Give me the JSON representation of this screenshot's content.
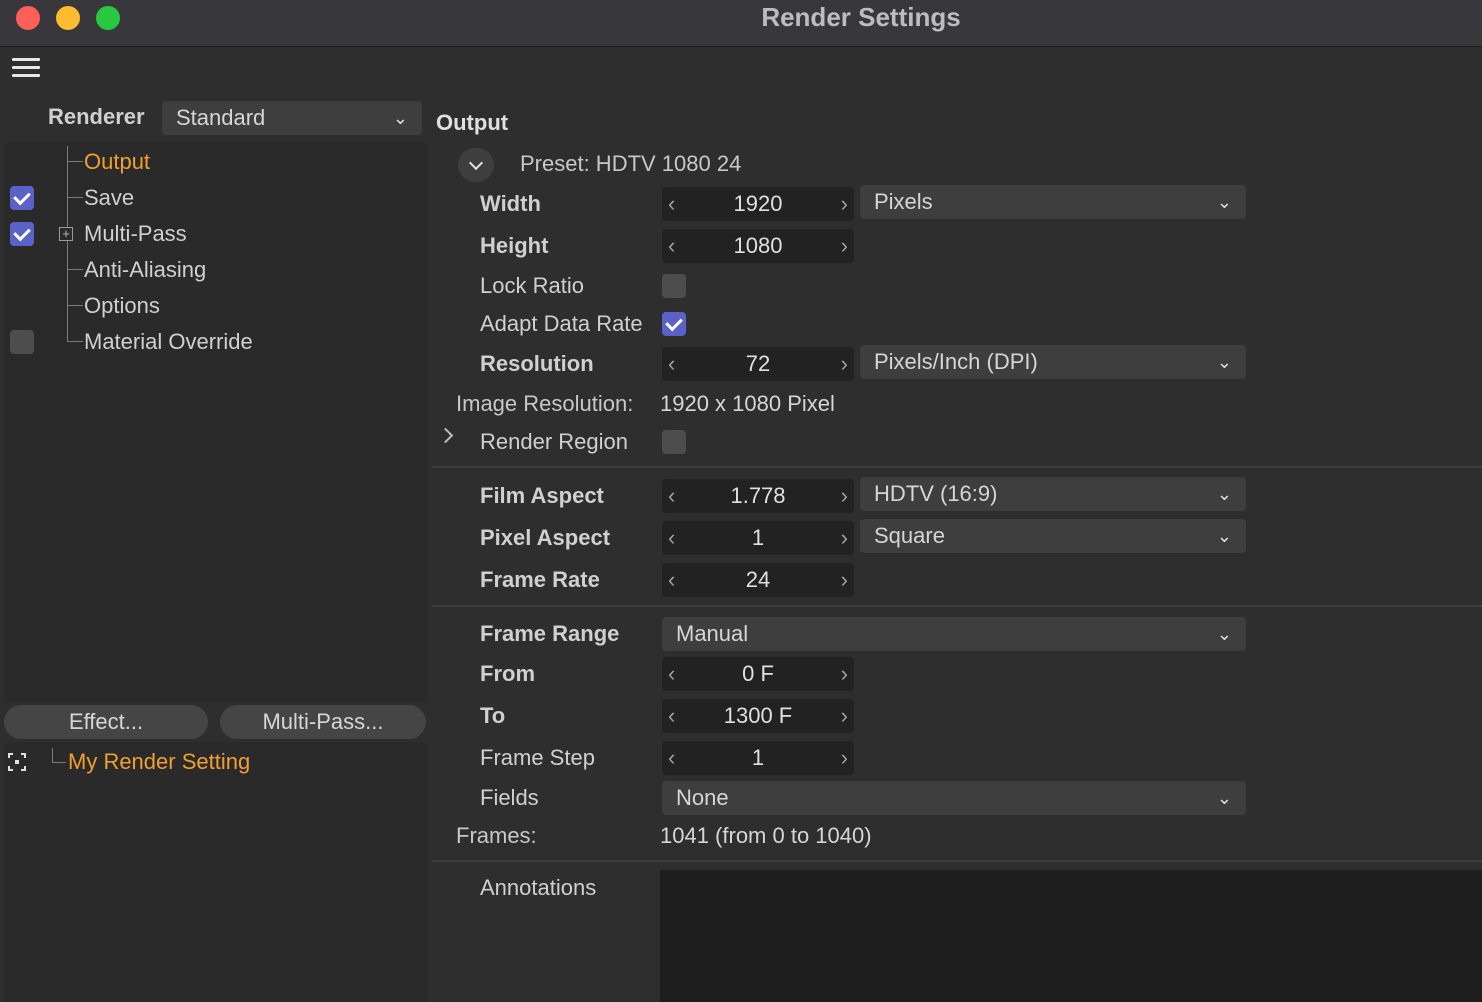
{
  "window": {
    "title": "Render Settings"
  },
  "colors": {
    "accent_orange": "#f0a030",
    "checkbox_blue": "#5a62c8"
  },
  "icons": {
    "menu": "hamburger-menu-icon",
    "expand": "chevron-down-icon",
    "focus": "focus-icon"
  },
  "left": {
    "renderer_label": "Renderer",
    "renderer_value": "Standard",
    "tree": [
      {
        "label": "Output",
        "active": true,
        "checkbox": null
      },
      {
        "label": "Save",
        "active": false,
        "checkbox": true
      },
      {
        "label": "Multi-Pass",
        "active": false,
        "checkbox": true
      },
      {
        "label": "Anti-Aliasing",
        "active": false,
        "checkbox": null
      },
      {
        "label": "Options",
        "active": false,
        "checkbox": null
      },
      {
        "label": "Material Override",
        "active": false,
        "checkbox": false
      }
    ],
    "effect_button": "Effect...",
    "multipass_button": "Multi-Pass...",
    "render_setting": "My Render Setting"
  },
  "output": {
    "title": "Output",
    "preset": "Preset: HDTV 1080 24",
    "width_label": "Width",
    "width_value": "1920",
    "width_unit": "Pixels",
    "height_label": "Height",
    "height_value": "1080",
    "lock_ratio_label": "Lock Ratio",
    "lock_ratio": false,
    "adapt_label": "Adapt Data Rate",
    "adapt": true,
    "resolution_label": "Resolution",
    "resolution_value": "72",
    "resolution_unit": "Pixels/Inch (DPI)",
    "image_res_label": "Image Resolution:",
    "image_res_value": "1920 x 1080 Pixel",
    "render_region_label": "Render Region",
    "render_region": false,
    "film_aspect_label": "Film Aspect",
    "film_aspect_value": "1.778",
    "film_aspect_preset": "HDTV (16:9)",
    "pixel_aspect_label": "Pixel Aspect",
    "pixel_aspect_value": "1",
    "pixel_aspect_preset": "Square",
    "frame_rate_label": "Frame Rate",
    "frame_rate_value": "24",
    "frame_range_label": "Frame Range",
    "frame_range_value": "Manual",
    "from_label": "From",
    "from_value": "0 F",
    "to_label": "To",
    "to_value": "1300 F",
    "frame_step_label": "Frame Step",
    "frame_step_value": "1",
    "fields_label": "Fields",
    "fields_value": "None",
    "frames_label": "Frames:",
    "frames_value": "1041 (from 0 to 1040)",
    "annotations_label": "Annotations"
  }
}
